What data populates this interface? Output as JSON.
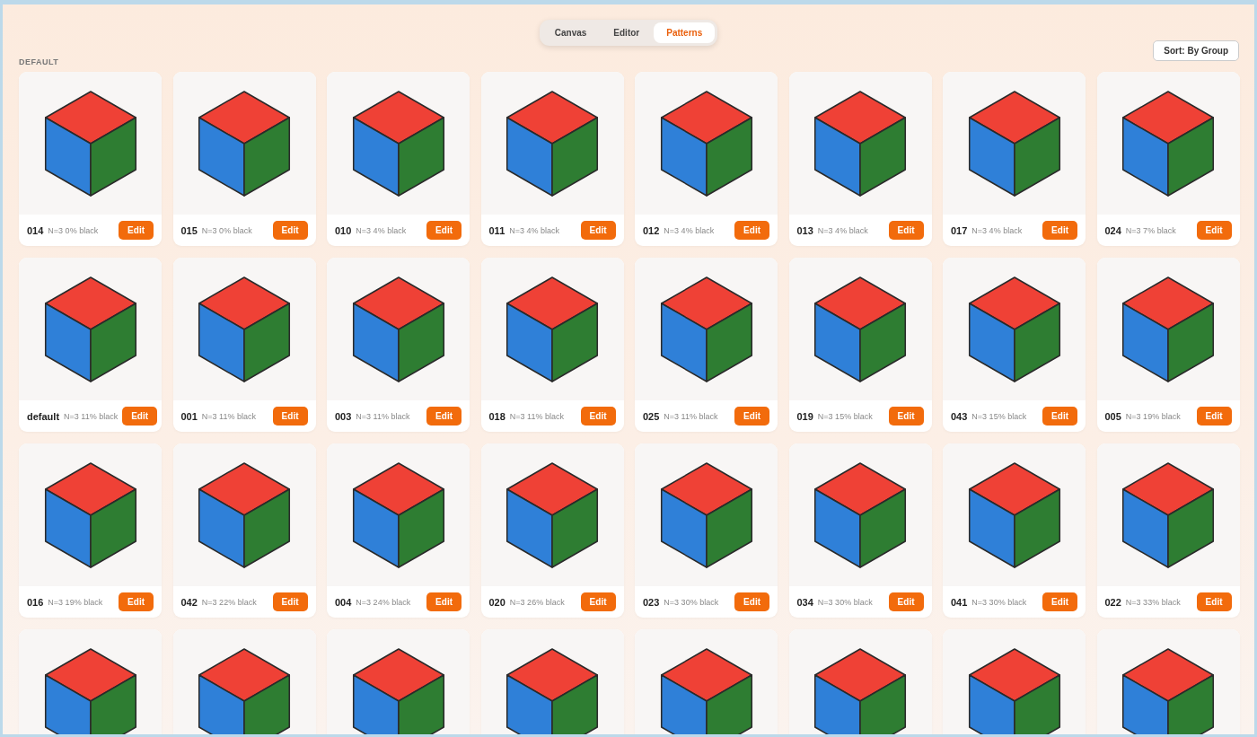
{
  "tabs": [
    {
      "label": "Canvas",
      "selected": false
    },
    {
      "label": "Editor",
      "selected": false
    },
    {
      "label": "Patterns",
      "selected": true
    }
  ],
  "sort_button": "Sort: By Group",
  "group_label": "DEFAULT",
  "cards": [
    {
      "kind": "full",
      "name": "014",
      "meta": "N=3 0% black",
      "button": "Edit"
    },
    {
      "kind": "full",
      "name": "015",
      "meta": "N=3 0% black",
      "button": "Edit"
    },
    {
      "kind": "full",
      "name": "010",
      "meta": "N=3 4% black",
      "button": "Edit"
    },
    {
      "kind": "full",
      "name": "011",
      "meta": "N=3 4% black",
      "button": "Edit"
    },
    {
      "kind": "full",
      "name": "012",
      "meta": "N=3 4% black",
      "button": "Edit"
    },
    {
      "kind": "full",
      "name": "013",
      "meta": "N=3 4% black",
      "button": "Edit"
    },
    {
      "kind": "full",
      "name": "017",
      "meta": "N=3 4% black",
      "button": "Edit"
    },
    {
      "kind": "full",
      "name": "024",
      "meta": "N=3 7% black",
      "button": "Edit"
    },
    {
      "kind": "full",
      "name": "default",
      "meta": "N=3 11% black",
      "button": "Edit"
    },
    {
      "kind": "full",
      "name": "001",
      "meta": "N=3 11% black",
      "button": "Edit"
    },
    {
      "kind": "full",
      "name": "003",
      "meta": "N=3 11% black",
      "button": "Edit"
    },
    {
      "kind": "full",
      "name": "018",
      "meta": "N=3 11% black",
      "button": "Edit"
    },
    {
      "kind": "full",
      "name": "025",
      "meta": "N=3 11% black",
      "button": "Edit"
    },
    {
      "kind": "full",
      "name": "019",
      "meta": "N=3 15% black",
      "button": "Edit"
    },
    {
      "kind": "full",
      "name": "043",
      "meta": "N=3 15% black",
      "button": "Edit"
    },
    {
      "kind": "full",
      "name": "005",
      "meta": "N=3 19% black",
      "button": "Edit"
    },
    {
      "kind": "full",
      "name": "016",
      "meta": "N=3 19% black",
      "button": "Edit"
    },
    {
      "kind": "full",
      "name": "042",
      "meta": "N=3 22% black",
      "button": "Edit"
    },
    {
      "kind": "full",
      "name": "004",
      "meta": "N=3 24% black",
      "button": "Edit"
    },
    {
      "kind": "full",
      "name": "020",
      "meta": "N=3 26% black",
      "button": "Edit"
    },
    {
      "kind": "full",
      "name": "023",
      "meta": "N=3 30% black",
      "button": "Edit"
    },
    {
      "kind": "full",
      "name": "034",
      "meta": "N=3 30% black",
      "button": "Edit"
    },
    {
      "kind": "full",
      "name": "041",
      "meta": "N=3 30% black",
      "button": "Edit"
    },
    {
      "kind": "full",
      "name": "022",
      "meta": "N=3 33% black",
      "button": "Edit"
    },
    {
      "kind": "clipped"
    },
    {
      "kind": "clipped"
    },
    {
      "kind": "clipped"
    },
    {
      "kind": "clipped"
    },
    {
      "kind": "clipped"
    },
    {
      "kind": "clipped"
    },
    {
      "kind": "clipped"
    },
    {
      "kind": "clipped"
    }
  ]
}
